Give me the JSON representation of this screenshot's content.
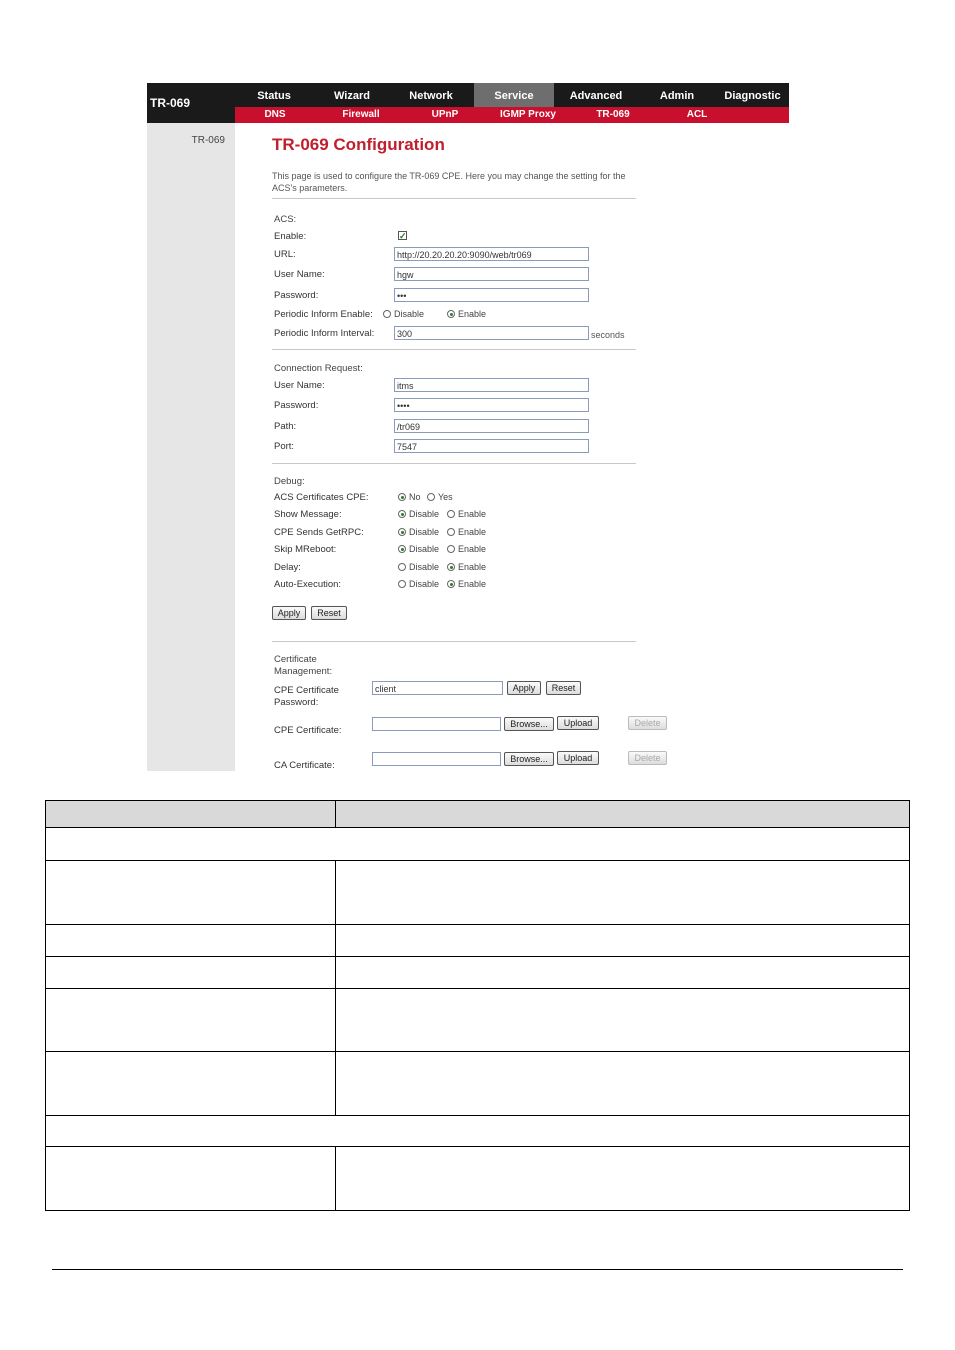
{
  "brand": "TR-069",
  "nav": {
    "items": [
      "Status",
      "Wizard",
      "Network",
      "Service",
      "Advanced",
      "Admin",
      "Diagnostic"
    ],
    "active": "Service"
  },
  "subnav": {
    "items": [
      "DNS",
      "Firewall",
      "UPnP",
      "IGMP Proxy",
      "TR-069",
      "ACL"
    ],
    "active": "TR-069"
  },
  "sidebar": {
    "item": "TR-069"
  },
  "page": {
    "title": "TR-069 Configuration",
    "intro": "This page is used to configure the TR-069 CPE. Here you may change the setting for the ACS's parameters."
  },
  "acs": {
    "section": "ACS:",
    "enable_label": "Enable:",
    "enable_checked": true,
    "url_label": "URL:",
    "url_value": "http://20.20.20.20:9090/web/tr069",
    "username_label": "User Name:",
    "username_value": "hgw",
    "password_label": "Password:",
    "password_value": "•••",
    "periodic_enable_label": "Periodic Inform Enable:",
    "periodic_interval_label": "Periodic Inform Interval:",
    "periodic_interval_value": "300",
    "seconds": "seconds"
  },
  "radio_text": {
    "disable": "Disable",
    "enable": "Enable",
    "no": "No",
    "yes": "Yes"
  },
  "conn": {
    "section": "Connection Request:",
    "username_label": "User Name:",
    "username_value": "itms",
    "password_label": "Password:",
    "password_value": "••••",
    "path_label": "Path:",
    "path_value": "/tr069",
    "port_label": "Port:",
    "port_value": "7547"
  },
  "debug": {
    "section": "Debug:",
    "acs_cert_label": "ACS Certificates CPE:",
    "show_msg_label": "Show Message:",
    "getrpc_label": "CPE Sends GetRPC:",
    "skip_label": "Skip MReboot:",
    "delay_label": "Delay:",
    "auto_label": "Auto-Execution:"
  },
  "buttons": {
    "apply": "Apply",
    "reset": "Reset",
    "browse": "Browse...",
    "upload": "Upload",
    "delete": "Delete"
  },
  "cert": {
    "section": "Certificate Management:",
    "cpe_pw_label": "CPE Certificate Password:",
    "cpe_pw_value": "client",
    "cpe_cert_label": "CPE Certificate:",
    "ca_cert_label": "CA Certificate:"
  }
}
